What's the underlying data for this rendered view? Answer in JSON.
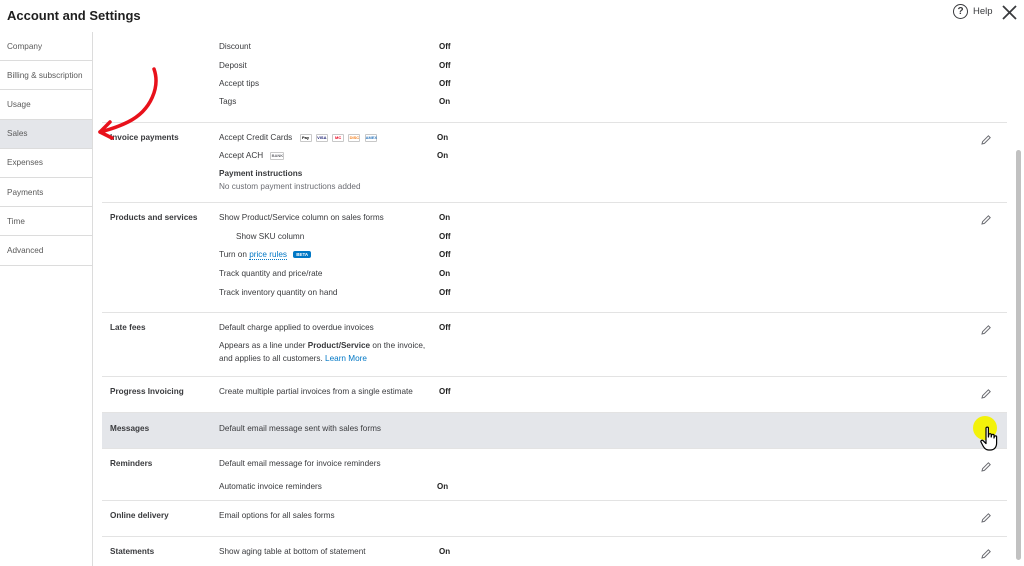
{
  "header": {
    "title": "Account and Settings",
    "help_icon_glyph": "?",
    "help_label": "Help",
    "close_icon": "close-icon"
  },
  "sidebar": {
    "items": [
      {
        "label": "Company"
      },
      {
        "label": "Billing & subscription"
      },
      {
        "label": "Usage"
      },
      {
        "label": "Sales",
        "active": true
      },
      {
        "label": "Expenses"
      },
      {
        "label": "Payments"
      },
      {
        "label": "Time"
      },
      {
        "label": "Advanced"
      }
    ]
  },
  "sections": {
    "top": {
      "discount": {
        "label": "Discount",
        "value": "Off"
      },
      "deposit": {
        "label": "Deposit",
        "value": "Off"
      },
      "tips": {
        "label": "Accept tips",
        "value": "Off"
      },
      "tags": {
        "label": "Tags",
        "value": "On"
      }
    },
    "invoice_payments": {
      "title": "Invoice payments",
      "credit_cards": {
        "label": "Accept Credit Cards",
        "value": "On"
      },
      "card_icons": [
        "Pay",
        "VISA",
        "MC",
        "DISC",
        "AMEX"
      ],
      "ach": {
        "label": "Accept ACH",
        "bank_icon": "BANK",
        "value": "On"
      },
      "instructions_title": "Payment instructions",
      "instructions_text": "No custom payment instructions added"
    },
    "products": {
      "title": "Products and services",
      "show_column": {
        "label": "Show Product/Service column on sales forms",
        "value": "On"
      },
      "sku": {
        "label": "Show SKU column",
        "value": "Off"
      },
      "price_rules": {
        "prefix": "Turn on",
        "link": "price rules",
        "badge": "BETA",
        "value": "Off"
      },
      "track_qty": {
        "label": "Track quantity and price/rate",
        "value": "On"
      },
      "track_inv": {
        "label": "Track inventory quantity on hand",
        "value": "Off"
      }
    },
    "late_fees": {
      "title": "Late fees",
      "default_charge": {
        "label": "Default charge applied to overdue invoices",
        "value": "Off"
      },
      "desc_1a": "Appears as a line under ",
      "desc_1b": "Product/Service",
      "desc_1c": " on the invoice,",
      "desc_2": "and applies to all customers.",
      "learn_more": "Learn More"
    },
    "progress": {
      "title": "Progress Invoicing",
      "create": {
        "label": "Create multiple partial invoices from a single estimate",
        "value": "Off"
      }
    },
    "messages": {
      "title": "Messages",
      "default_email": "Default email message sent with sales forms"
    },
    "reminders": {
      "title": "Reminders",
      "default_email": "Default email message for invoice reminders",
      "automatic": {
        "label": "Automatic invoice reminders",
        "value": "On"
      }
    },
    "online_delivery": {
      "title": "Online delivery",
      "email_options": "Email options for all sales forms"
    },
    "statements": {
      "title": "Statements",
      "aging": {
        "label": "Show aging table at bottom of statement",
        "value": "On"
      }
    }
  },
  "colors": {
    "accent": "#0077c5",
    "highlight_row": "#e4e6ea",
    "annotation_arrow": "#e8111b",
    "cursor_halo": "#f3f20a"
  },
  "icons": {
    "edit": "pencil-icon",
    "help": "help-circle-icon",
    "close": "close-icon",
    "cursor": "hand-pointer-icon"
  }
}
